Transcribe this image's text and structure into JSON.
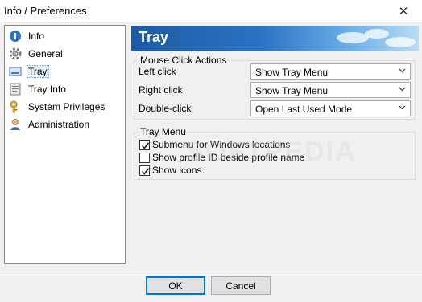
{
  "window": {
    "title": "Info / Preferences",
    "close_glyph": "✕"
  },
  "nav": {
    "items": [
      {
        "label": "Info",
        "icon": "info-icon"
      },
      {
        "label": "General",
        "icon": "gear-icon"
      },
      {
        "label": "Tray",
        "icon": "tray-icon",
        "selected": true
      },
      {
        "label": "Tray Info",
        "icon": "document-icon"
      },
      {
        "label": "System Privileges",
        "icon": "key-icon"
      },
      {
        "label": "Administration",
        "icon": "user-icon"
      }
    ]
  },
  "panel": {
    "title": "Tray",
    "mouse_group": {
      "title": "Mouse Click Actions",
      "rows": [
        {
          "label": "Left click",
          "value": "Show Tray Menu"
        },
        {
          "label": "Right click",
          "value": "Show Tray Menu"
        },
        {
          "label": "Double-click",
          "value": "Open Last Used Mode"
        }
      ]
    },
    "menu_group": {
      "title": "Tray Menu",
      "options": [
        {
          "label": "Submenu for Windows locations",
          "checked": true
        },
        {
          "label": "Show profile ID beside profile name",
          "checked": false
        },
        {
          "label": "Show icons",
          "checked": true
        }
      ]
    }
  },
  "buttons": {
    "ok": "OK",
    "cancel": "Cancel"
  },
  "watermark": "SOFTPEDIA",
  "colors": {
    "banner_start": "#1d5aa3",
    "banner_end": "#b9dcf6",
    "selection": "#e5f3ff",
    "default_button_border": "#0078d7"
  }
}
